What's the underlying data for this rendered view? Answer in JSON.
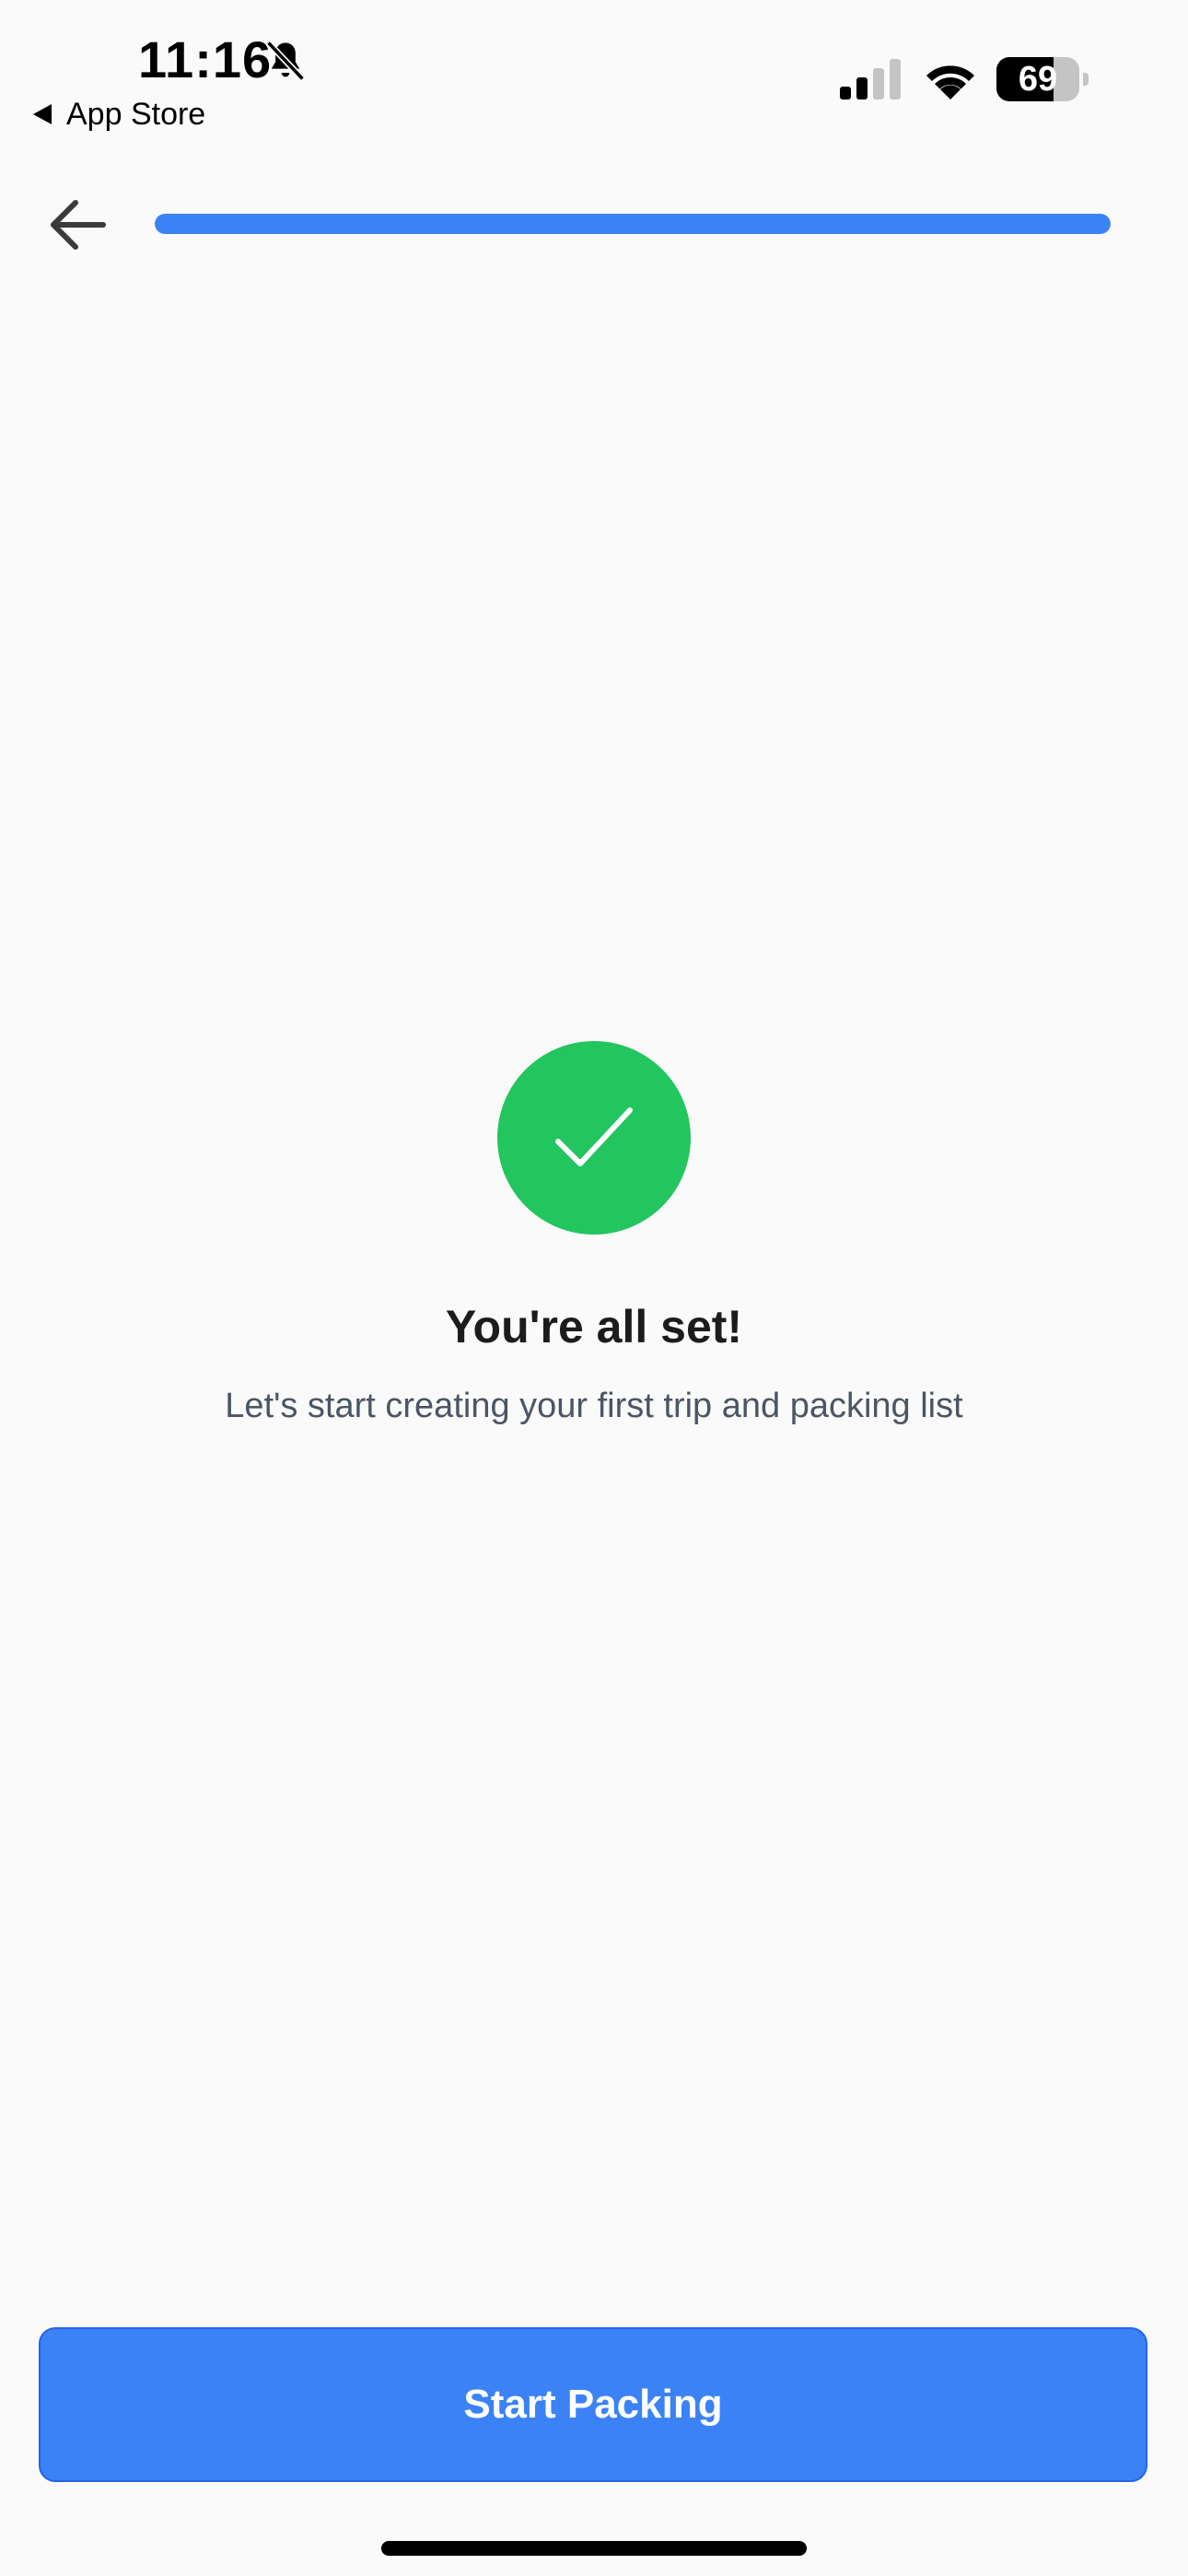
{
  "status_bar": {
    "time": "11:16",
    "back_app_label": "App Store",
    "battery_level": "69",
    "battery_fraction": 0.69,
    "bell_icon": "bell-slash-icon",
    "signal_icon": "cellular-signal-icon",
    "wifi_icon": "wifi-icon"
  },
  "header": {
    "back_icon": "arrow-left-icon",
    "progress_fraction": 1.0
  },
  "main": {
    "success_icon": "checkmark-icon",
    "title": "You're all set!",
    "subtitle": "Let's start creating your first trip and packing list"
  },
  "cta": {
    "label": "Start Packing"
  },
  "colors": {
    "accent": "#3b82f6",
    "success": "#22c55e",
    "background": "#fafafa"
  }
}
